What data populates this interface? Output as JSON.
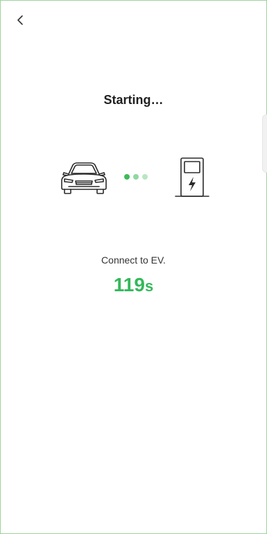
{
  "header": {
    "back_icon": "chevron-left-icon"
  },
  "main": {
    "title": "Starting…",
    "illustration": {
      "car_icon": "car-icon",
      "charger_icon": "ev-charger-icon",
      "dots_colors": [
        "#3dbb5a",
        "#8fd8a0",
        "#b9e6c3"
      ]
    },
    "status_text": "Connect to EV.",
    "countdown": {
      "value": "119",
      "unit": "s"
    }
  },
  "colors": {
    "accent": "#34b85a",
    "frame_border": "#9bd49a"
  }
}
